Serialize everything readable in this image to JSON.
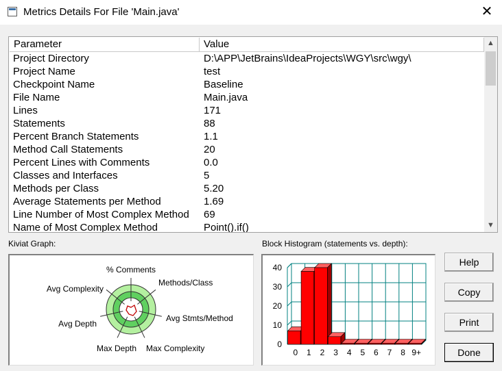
{
  "window": {
    "title": "Metrics Details For File 'Main.java'",
    "close_glyph": "✕"
  },
  "table": {
    "columns": [
      "Parameter",
      "Value"
    ],
    "rows": [
      {
        "param": "Project Directory",
        "value": "D:\\APP\\JetBrains\\IdeaProjects\\WGY\\src\\wgy\\"
      },
      {
        "param": "Project Name",
        "value": "test"
      },
      {
        "param": "Checkpoint Name",
        "value": "Baseline"
      },
      {
        "param": "File Name",
        "value": "Main.java"
      },
      {
        "param": "Lines",
        "value": "171"
      },
      {
        "param": "Statements",
        "value": "88"
      },
      {
        "param": "Percent Branch Statements",
        "value": "1.1"
      },
      {
        "param": "Method Call Statements",
        "value": "20"
      },
      {
        "param": "Percent Lines with Comments",
        "value": "0.0"
      },
      {
        "param": "Classes and Interfaces",
        "value": "5"
      },
      {
        "param": "Methods per Class",
        "value": "5.20"
      },
      {
        "param": "Average Statements per Method",
        "value": "1.69"
      },
      {
        "param": "Line Number of Most Complex Method",
        "value": "69"
      },
      {
        "param": "Name of Most Complex Method",
        "value": "Point().if()"
      }
    ]
  },
  "kiviat": {
    "label": "Kiviat Graph:",
    "axes": [
      "% Comments",
      "Methods/Class",
      "Avg Stmts/Method",
      "Max Complexity",
      "Max Depth",
      "Avg Depth",
      "Avg Complexity"
    ]
  },
  "histogram": {
    "label": "Block Histogram (statements vs. depth):"
  },
  "chart_data": {
    "type": "bar",
    "categories": [
      "0",
      "1",
      "2",
      "3",
      "4",
      "5",
      "6",
      "7",
      "8",
      "9+"
    ],
    "values": [
      7,
      38,
      40,
      4,
      0,
      0,
      0,
      0,
      0,
      0
    ],
    "ylim": [
      0,
      40
    ],
    "yticks": [
      "0",
      "10",
      "20",
      "30",
      "40"
    ],
    "bar_color": "#ff0000",
    "grid_color": "#008080",
    "grid": true
  },
  "buttons": {
    "help": "Help",
    "copy": "Copy",
    "print": "Print",
    "done": "Done"
  }
}
